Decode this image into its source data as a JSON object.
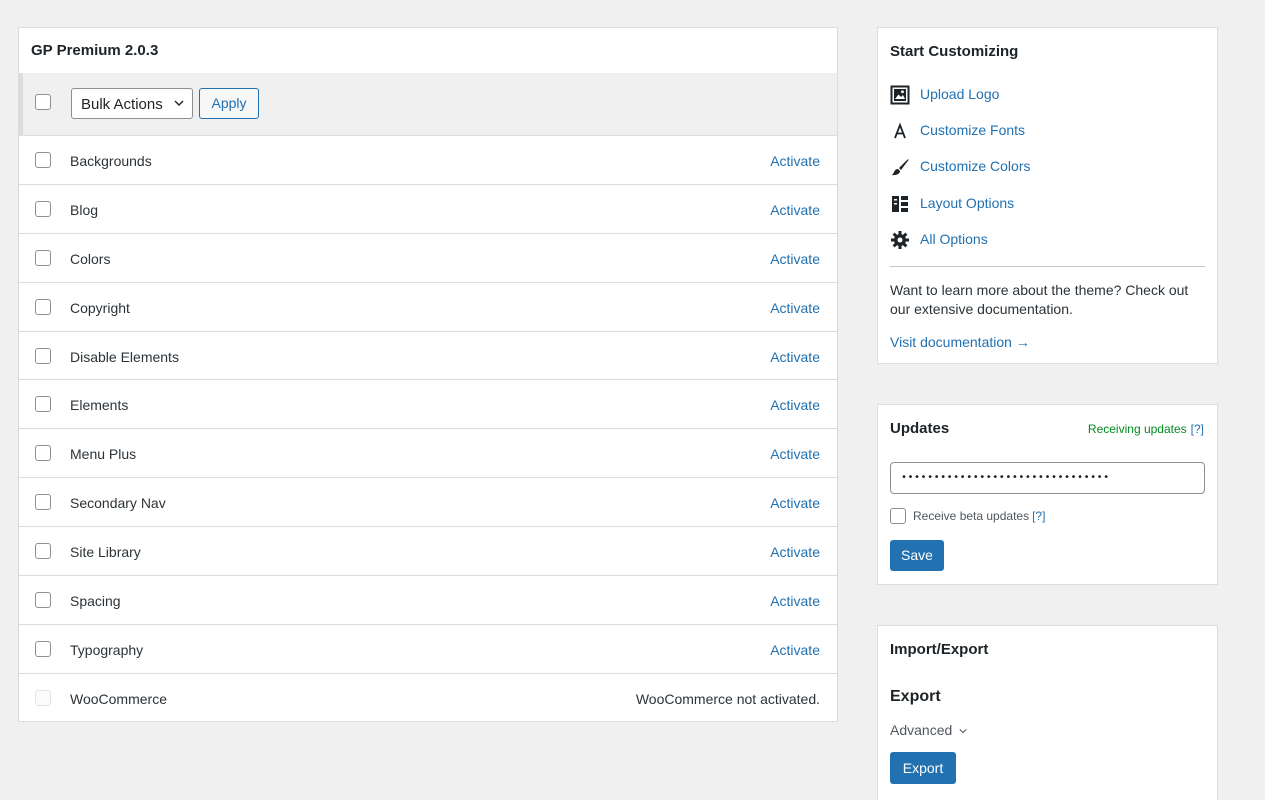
{
  "modules": {
    "title": "GP Premium 2.0.3",
    "bulk_select": "Bulk Actions",
    "apply_label": "Apply",
    "items": [
      {
        "name": "Backgrounds",
        "action": "Activate"
      },
      {
        "name": "Blog",
        "action": "Activate"
      },
      {
        "name": "Colors",
        "action": "Activate"
      },
      {
        "name": "Copyright",
        "action": "Activate"
      },
      {
        "name": "Disable Elements",
        "action": "Activate"
      },
      {
        "name": "Elements",
        "action": "Activate"
      },
      {
        "name": "Menu Plus",
        "action": "Activate"
      },
      {
        "name": "Secondary Nav",
        "action": "Activate"
      },
      {
        "name": "Site Library",
        "action": "Activate"
      },
      {
        "name": "Spacing",
        "action": "Activate"
      },
      {
        "name": "Typography",
        "action": "Activate"
      },
      {
        "name": "WooCommerce",
        "note": "WooCommerce not activated."
      }
    ]
  },
  "customize": {
    "title": "Start Customizing",
    "items": [
      {
        "label": "Upload Logo",
        "icon": "image-icon"
      },
      {
        "label": "Customize Fonts",
        "icon": "font-icon"
      },
      {
        "label": "Customize Colors",
        "icon": "paintbrush-icon"
      },
      {
        "label": "Layout Options",
        "icon": "layout-icon"
      },
      {
        "label": "All Options",
        "icon": "gear-icon"
      }
    ],
    "learn_text": "Want to learn more about the theme? Check out our extensive documentation.",
    "doc_link": "Visit documentation →"
  },
  "updates": {
    "title": "Updates",
    "status": "Receiving updates",
    "help": "[?]",
    "license_value": "••••••••••••••••••••••••••••••••",
    "beta_label": "Receive beta updates",
    "beta_help": "[?]",
    "save_label": "Save"
  },
  "import_export": {
    "title": "Import/Export",
    "export_heading": "Export",
    "advanced_label": "Advanced",
    "export_label": "Export"
  },
  "colors": {
    "accent": "#2271b1",
    "success": "#008a20"
  }
}
